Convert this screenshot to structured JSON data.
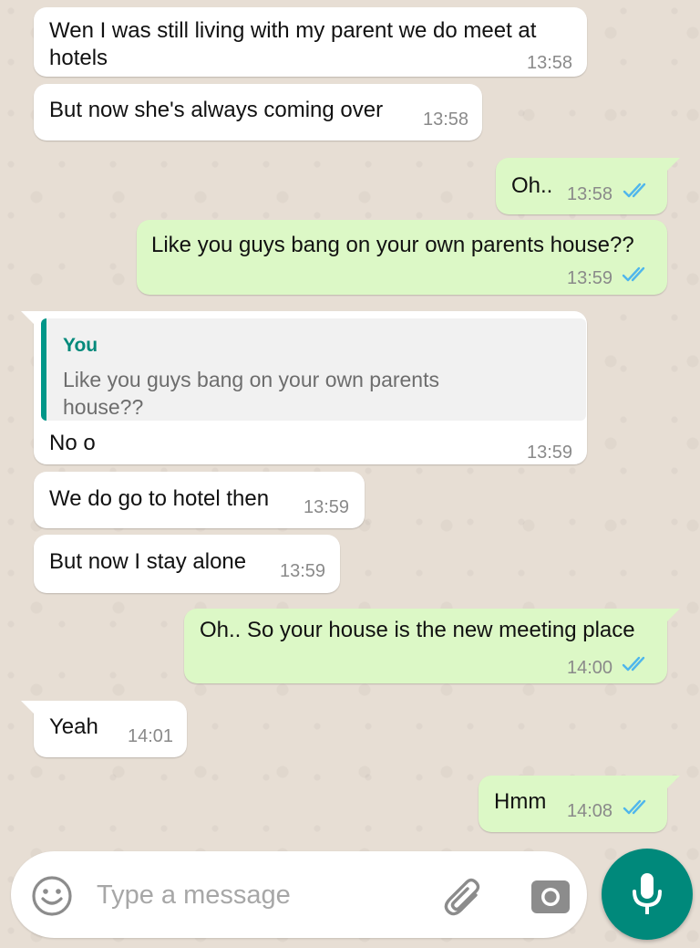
{
  "messages": [
    {
      "direction": "in",
      "text": "Wen I was still living with my parent we do meet at hotels",
      "time": "13:58"
    },
    {
      "direction": "in",
      "text": "But now she's always coming over",
      "time": "13:58"
    },
    {
      "direction": "out",
      "text": "Oh..",
      "time": "13:58",
      "status": "read"
    },
    {
      "direction": "out",
      "text": "Like you guys bang on your own parents house??",
      "time": "13:59",
      "status": "read"
    },
    {
      "direction": "in",
      "reply_to": {
        "author": "You",
        "text": "Like you guys bang on your own parents house??"
      },
      "text": "No o",
      "time": "13:59"
    },
    {
      "direction": "in",
      "text": "We do go to hotel then",
      "time": "13:59"
    },
    {
      "direction": "in",
      "text": "But now I stay alone",
      "time": "13:59"
    },
    {
      "direction": "out",
      "text": "Oh.. So your house is the new meeting place",
      "time": "14:00",
      "status": "read"
    },
    {
      "direction": "in",
      "text": "Yeah",
      "time": "14:01"
    },
    {
      "direction": "out",
      "text": "Hmm",
      "time": "14:08",
      "status": "read"
    }
  ],
  "composer": {
    "placeholder": "Type a message",
    "emoji_icon": "emoji-icon",
    "attach_icon": "paperclip-icon",
    "camera_icon": "camera-icon",
    "send_icon": "microphone-icon"
  },
  "colors": {
    "incoming_bubble": "#ffffff",
    "outgoing_bubble": "#dcf8c6",
    "read_ticks": "#4fb6ec",
    "accent": "#00897b",
    "chat_background": "#e7ded4"
  }
}
